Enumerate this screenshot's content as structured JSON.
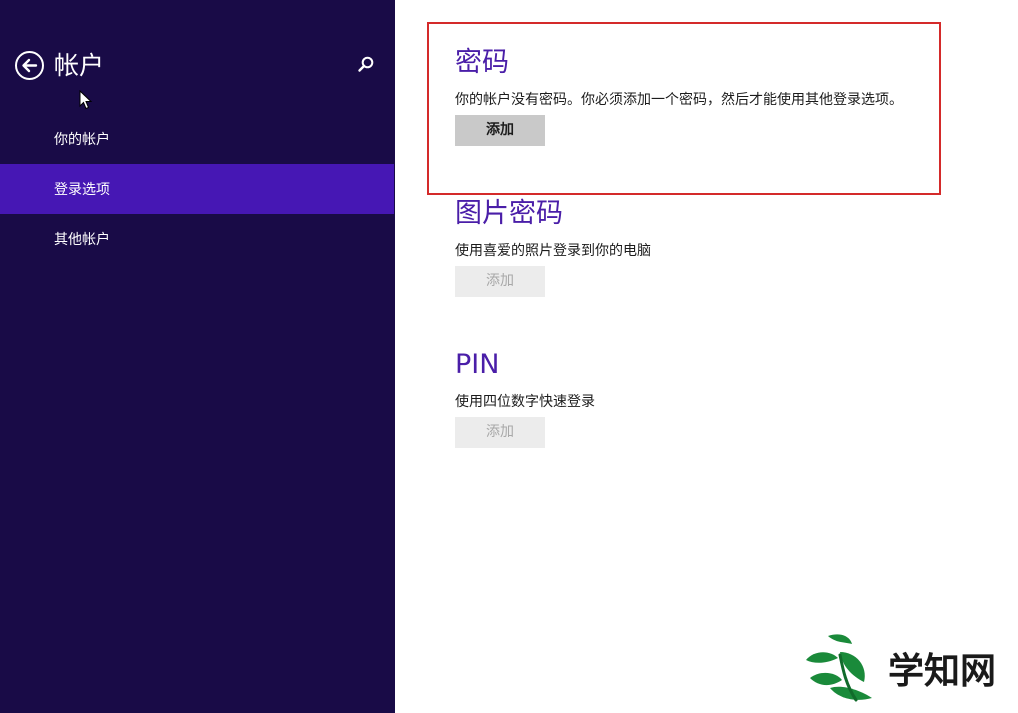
{
  "sidebar": {
    "title": "帐户",
    "items": [
      {
        "label": "你的帐户",
        "active": false
      },
      {
        "label": "登录选项",
        "active": true
      },
      {
        "label": "其他帐户",
        "active": false
      }
    ]
  },
  "main": {
    "sections": [
      {
        "title": "密码",
        "description": "你的帐户没有密码。你必须添加一个密码，然后才能使用其他登录选项。",
        "button_label": "添加",
        "button_enabled": true
      },
      {
        "title": "图片密码",
        "description": "使用喜爱的照片登录到你的电脑",
        "button_label": "添加",
        "button_enabled": false
      },
      {
        "title": "PIN",
        "description": "使用四位数字快速登录",
        "button_label": "添加",
        "button_enabled": false
      }
    ]
  },
  "watermark": {
    "text": "学知网"
  },
  "colors": {
    "sidebar_bg": "#190b47",
    "active_item": "#4617b4",
    "heading": "#4a1ea8",
    "highlight_border": "#d42a2a"
  },
  "icons": {
    "back": "back-arrow-circle-icon",
    "search": "search-icon",
    "cursor": "mouse-pointer-icon"
  }
}
